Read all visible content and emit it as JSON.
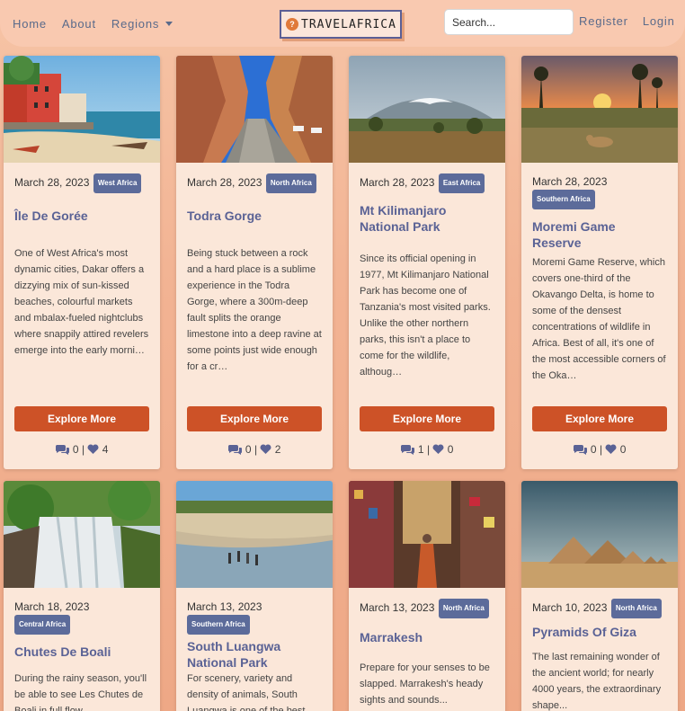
{
  "nav": {
    "home": "Home",
    "about": "About",
    "regions": "Regions",
    "logo": "TRAVELAFRICA",
    "search_placeholder": "Search...",
    "register": "Register",
    "login": "Login"
  },
  "explore_label": "Explore More",
  "separator": "|",
  "cards": [
    {
      "date": "March 28, 2023",
      "region": "West Africa",
      "title": "Île De Gorée",
      "desc": "One of West Africa's most dynamic cities, Dakar offers a dizzying mix of sun-kissed beaches, colourful markets and mbalax-fueled nightclubs where snappily attired revelers emerge into the early morni…",
      "comments": "0",
      "likes": "4"
    },
    {
      "date": "March 28, 2023",
      "region": "North Africa",
      "title": "Todra Gorge",
      "desc": "Being stuck between a rock and a hard place is a sublime experience in the Todra Gorge, where a 300m-deep fault splits the orange limestone into a deep ravine at some points just wide enough for a cr…",
      "comments": "0",
      "likes": "2"
    },
    {
      "date": "March 28, 2023",
      "region": "East Africa",
      "title": "Mt Kilimanjaro National Park",
      "desc": "Since its official opening in 1977, Mt Kilimanjaro National Park has become one of Tanzania's most visited parks. Unlike the other northern parks, this isn't a place to come for the wildlife, althoug…",
      "comments": "1",
      "likes": "0"
    },
    {
      "date": "March 28, 2023",
      "region": "Southern Africa",
      "title": "Moremi Game Reserve",
      "desc": "Moremi Game Reserve, which covers one-third of the Okavango Delta, is home to some of the densest concentrations of wildlife in Africa. Best of all, it's one of the most accessible corners of the Oka…",
      "comments": "0",
      "likes": "0"
    },
    {
      "date": "March 18, 2023",
      "region": "Central Africa",
      "title": "Chutes De Boali",
      "desc": "During the rainy season, you'll be able to see Les Chutes de Boali in full flow..."
    },
    {
      "date": "March 13, 2023",
      "region": "Southern Africa",
      "title": "South Luangwa National Park",
      "desc": "For scenery, variety and density of animals, South Luangwa is one of the best parks..."
    },
    {
      "date": "March 13, 2023",
      "region": "North Africa",
      "title": "Marrakesh",
      "desc": "Prepare for your senses to be slapped. Marrakesh's heady sights and sounds..."
    },
    {
      "date": "March 10, 2023",
      "region": "North Africa",
      "title": "Pyramids Of Giza",
      "desc": "The last remaining wonder of the ancient world; for nearly 4000 years, the extraordinary shape..."
    }
  ]
}
